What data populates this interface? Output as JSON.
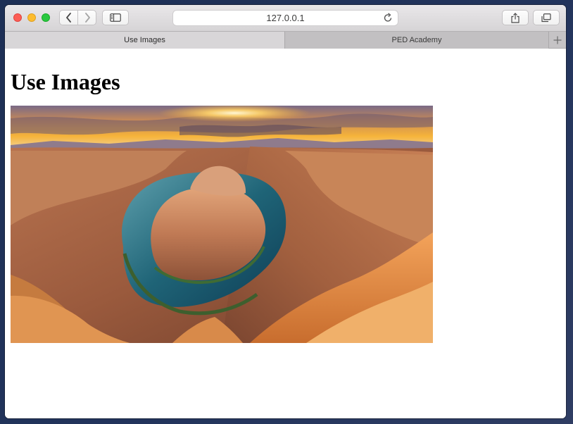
{
  "browser": {
    "url": "127.0.0.1",
    "tabs": [
      {
        "label": "Use Images",
        "active": true
      },
      {
        "label": "PED Academy",
        "active": false
      }
    ],
    "icons": {
      "back": "chevron-left-icon",
      "forward": "chevron-right-icon",
      "sidebar": "sidebar-icon",
      "reload": "reload-icon",
      "share": "share-icon",
      "tabs": "tabs-overview-icon",
      "new_tab": "plus-icon"
    },
    "colors": {
      "close": "#fc5d55",
      "minimize": "#fdbc2e",
      "zoom": "#29c840"
    }
  },
  "page": {
    "heading": "Use Images",
    "image": {
      "subject": "canyon river bend at sunset"
    }
  }
}
